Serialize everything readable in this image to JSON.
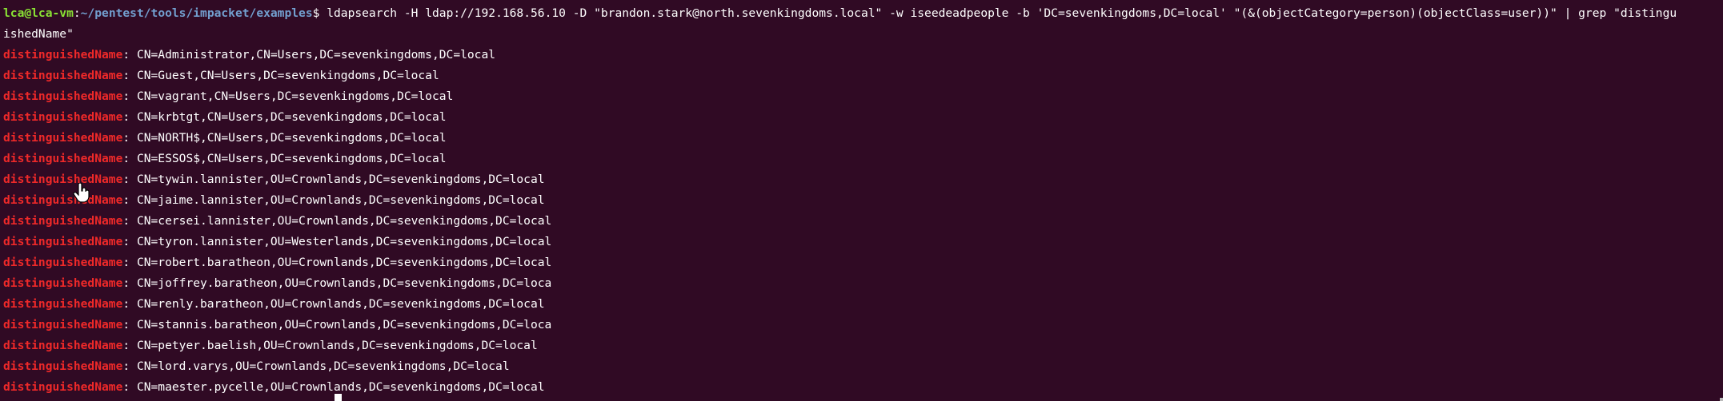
{
  "terminal": {
    "prompt_user_host": "lca@lca-vm",
    "prompt_separator": ":",
    "prompt_path": "~/pentest/tools/impacket/examples",
    "prompt_symbol": "$",
    "command": " ldapsearch -H ldap://192.168.56.10 -D \"brandon.stark@north.sevenkingdoms.local\" -w iseedeadpeople -b 'DC=sevenkingdoms,DC=local' \"(&(objectCategory=person)(objectClass=user))\" | grep \"distingu",
    "command_wrap": "ishedName\"",
    "match_label": "distinguishedName",
    "output_lines": [
      ": CN=Administrator,CN=Users,DC=sevenkingdoms,DC=local",
      ": CN=Guest,CN=Users,DC=sevenkingdoms,DC=local",
      ": CN=vagrant,CN=Users,DC=sevenkingdoms,DC=local",
      ": CN=krbtgt,CN=Users,DC=sevenkingdoms,DC=local",
      ": CN=NORTH$,CN=Users,DC=sevenkingdoms,DC=local",
      ": CN=ESSOS$,CN=Users,DC=sevenkingdoms,DC=local",
      ": CN=tywin.lannister,OU=Crownlands,DC=sevenkingdoms,DC=local",
      ": CN=jaime.lannister,OU=Crownlands,DC=sevenkingdoms,DC=local",
      ": CN=cersei.lannister,OU=Crownlands,DC=sevenkingdoms,DC=local",
      ": CN=tyron.lannister,OU=Westerlands,DC=sevenkingdoms,DC=local",
      ": CN=robert.baratheon,OU=Crownlands,DC=sevenkingdoms,DC=local",
      ": CN=joffrey.baratheon,OU=Crownlands,DC=sevenkingdoms,DC=loca",
      ": CN=renly.baratheon,OU=Crownlands,DC=sevenkingdoms,DC=local",
      ": CN=stannis.baratheon,OU=Crownlands,DC=sevenkingdoms,DC=loca",
      ": CN=petyer.baelish,OU=Crownlands,DC=sevenkingdoms,DC=local",
      ": CN=lord.varys,OU=Crownlands,DC=sevenkingdoms,DC=local",
      ": CN=maester.pycelle,OU=Crownlands,DC=sevenkingdoms,DC=local"
    ]
  },
  "colors": {
    "background": "#300a24",
    "prompt_user": "#8ae234",
    "prompt_path": "#729fcf",
    "grep_match": "#ef2929",
    "text": "#ffffff"
  },
  "icons": {
    "mouse_pointer": "hand-pointer-icon"
  }
}
